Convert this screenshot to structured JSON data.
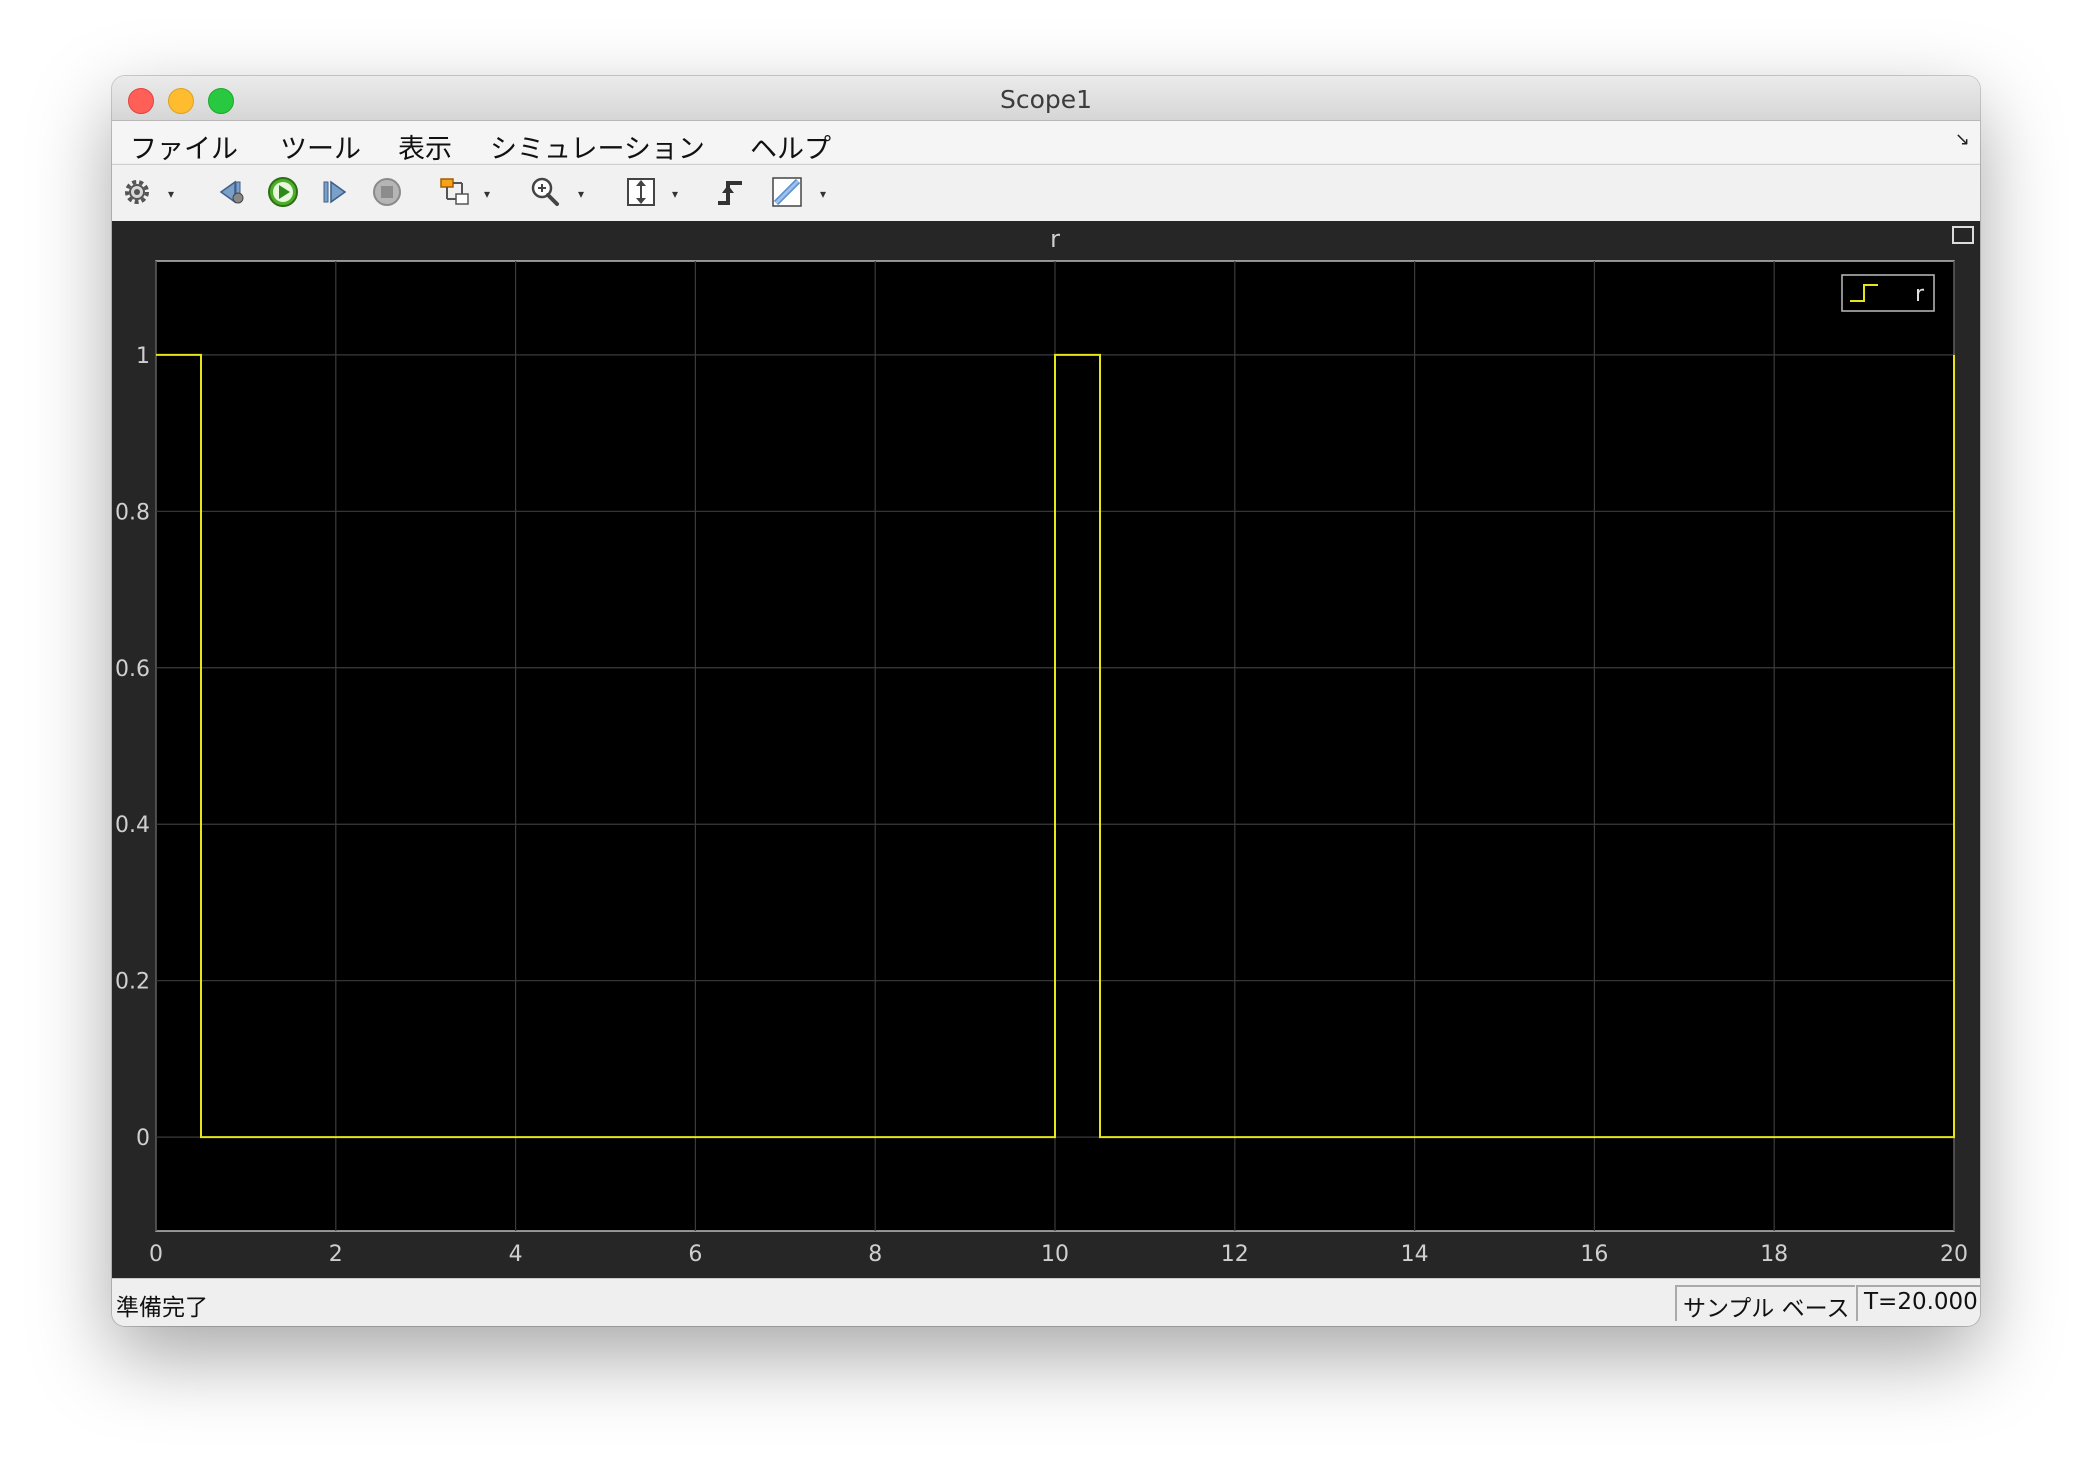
{
  "window": {
    "title": "Scope1"
  },
  "menu": {
    "items": [
      "ファイル",
      "ツール",
      "表示",
      "シミュレーション",
      "ヘルプ"
    ]
  },
  "toolbar": {
    "buttons": [
      {
        "name": "settings",
        "icon": "gear-icon",
        "dropdown": true
      },
      {
        "name": "step-back",
        "icon": "step-back-icon"
      },
      {
        "name": "run",
        "icon": "play-icon"
      },
      {
        "name": "step-forward",
        "icon": "step-forward-icon"
      },
      {
        "name": "stop",
        "icon": "stop-icon"
      },
      {
        "name": "highlight-block",
        "icon": "block-diagram-icon",
        "dropdown": true
      },
      {
        "name": "zoom",
        "icon": "zoom-in-icon",
        "dropdown": true
      },
      {
        "name": "scale-axes",
        "icon": "scale-y-axis-icon",
        "dropdown": true
      },
      {
        "name": "triggers",
        "icon": "trigger-icon"
      },
      {
        "name": "measurements",
        "icon": "ruler-icon",
        "dropdown": true
      }
    ]
  },
  "chart_data": {
    "type": "line",
    "title": "r",
    "xlabel": "",
    "ylabel": "",
    "xlim": [
      0,
      20
    ],
    "ylim": [
      -0.12,
      1.12
    ],
    "x_ticks": [
      0,
      2,
      4,
      6,
      8,
      10,
      12,
      14,
      16,
      18,
      20
    ],
    "y_ticks": [
      0,
      0.2,
      0.4,
      0.6,
      0.8,
      1
    ],
    "y_tick_labels": [
      "0",
      "0.2",
      "0.4",
      "0.6",
      "0.8",
      "1"
    ],
    "grid": true,
    "legend": {
      "position": "top-right",
      "entries": [
        "r"
      ]
    },
    "background": "#000000",
    "axes_color": "#bdbdbd",
    "series": [
      {
        "name": "r",
        "color": "#e5e51a",
        "step": true,
        "x": [
          0,
          0.5,
          0.5,
          10,
          10,
          10.5,
          10.5,
          20,
          20
        ],
        "y": [
          1,
          1,
          0,
          0,
          1,
          1,
          0,
          0,
          1
        ]
      }
    ]
  },
  "status": {
    "text": "準備完了",
    "mode": "サンプル ベース",
    "time": "T=20.000"
  }
}
